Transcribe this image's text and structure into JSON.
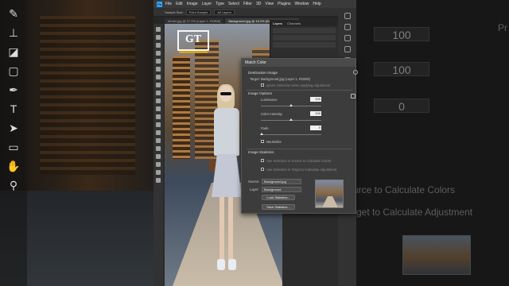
{
  "photoshop": {
    "menu": [
      "File",
      "Edit",
      "Image",
      "Layer",
      "Type",
      "Select",
      "Filter",
      "3D",
      "View",
      "Plugins",
      "Window",
      "Help"
    ],
    "options": {
      "sample_size": "Sample Size:",
      "point_sample": "Point Sample",
      "all_layers": "All Layers"
    },
    "tabs": [
      "Model.jpg @ 27.2% (Layer 1, RGB/8)",
      "Background.jpg @ 16.2% (Background, RGB/8)"
    ],
    "layers_panel": {
      "tabs": [
        "Layers",
        "Channels"
      ]
    },
    "logo": "GT"
  },
  "dialog": {
    "title": "Match Color",
    "destination_image": "Destination Image",
    "target_label": "Target:",
    "target_value": "Background.jpg (Layer 1, RGB/8)",
    "ignore_selection": "Ignore Selection when Applying Adjustment",
    "image_options": "Image Options",
    "luminance_label": "Luminance",
    "luminance_value": "100",
    "color_intensity_label": "Color Intensity",
    "color_intensity_value": "100",
    "fade_label": "Fade",
    "fade_value": "0",
    "neutralize": "Neutralize",
    "image_statistics": "Image Statistics",
    "use_selection_source": "Use Selection in Source to Calculate Colors",
    "use_selection_target": "Use Selection in Target to Calculate Adjustment",
    "source_label": "Source:",
    "source_value": "Background.jpg",
    "layer_label": "Layer:",
    "layer_value": "Background",
    "load_statistics": "Load Statistics...",
    "save_statistics": "Save Statistics..."
  },
  "background_right": {
    "values": [
      "100",
      "100",
      "0"
    ],
    "text_line1": "urce to Calculate Colors",
    "text_line2": "rget to Calculate Adjustment",
    "top_label": "Pr"
  }
}
